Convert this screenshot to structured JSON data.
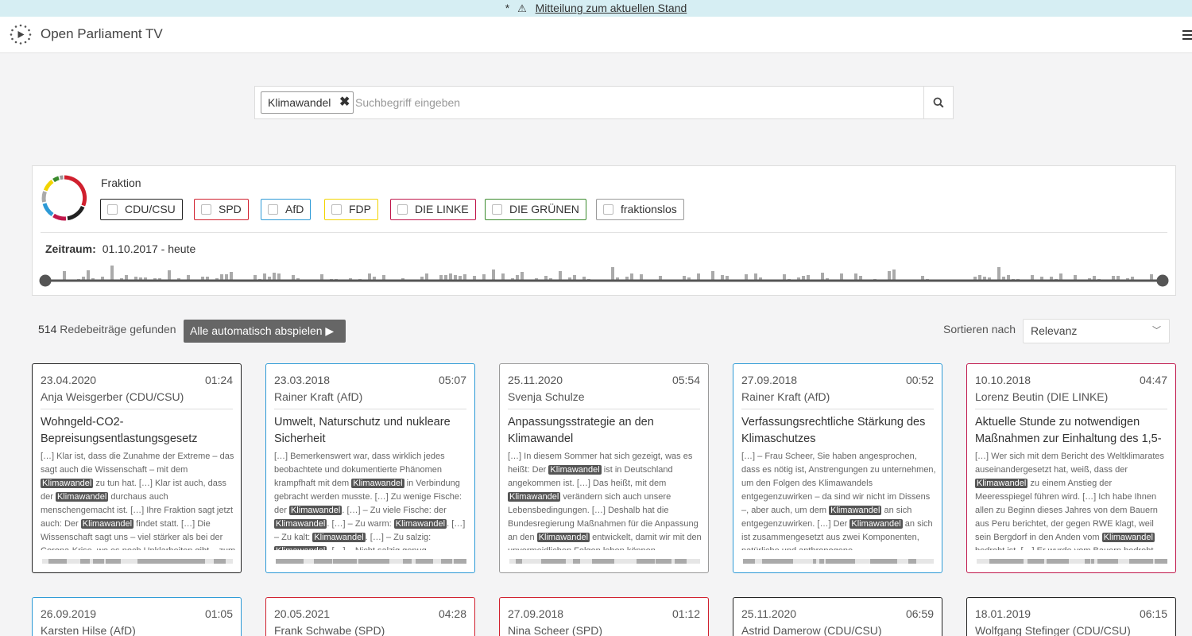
{
  "notice": {
    "prefix": "*",
    "link": "Mitteilung zum aktuellen Stand"
  },
  "brand": "Open Parliament TV",
  "search": {
    "chip": "Klimawandel",
    "placeholder": "Suchbegriff eingeben"
  },
  "filter": {
    "fraktion_label": "Fraktion",
    "parties": [
      {
        "label": "CDU/CSU",
        "color": "#222222"
      },
      {
        "label": "SPD",
        "color": "#d0202e"
      },
      {
        "label": "AfD",
        "color": "#2d9ad6"
      },
      {
        "label": "FDP",
        "color": "#f2d400"
      },
      {
        "label": "DIE LINKE",
        "color": "#c0174b"
      },
      {
        "label": "DIE GRÜNEN",
        "color": "#3a8a2c"
      },
      {
        "label": "fraktionslos",
        "color": "#999999"
      }
    ],
    "zeitraum_label": "Zeitraum:",
    "zeitraum_value": "01.10.2017 - heute"
  },
  "results": {
    "count": "514",
    "count_label": "Redebeiträge gefunden",
    "autoplay": "Alle automatisch abspielen ▶",
    "sort_label": "Sortieren nach",
    "sort_value": "Relevanz"
  },
  "cards": [
    {
      "date": "23.04.2020",
      "duration": "01:24",
      "speaker": "Anja Weisgerber (CDU/CSU)",
      "title": "Wohngeld-CO2-Bepreisungsentlastungsgesetz",
      "color": "#222222",
      "snippet": [
        "[…] Klar ist, dass die Zunahme der Extreme – das sagt auch die Wissenschaft – mit dem ",
        "Klimawandel",
        " zu tun hat. […] Klar ist auch, dass der ",
        "Klimawandel",
        " durchaus auch menschengemacht ist. […] Ihre Fraktion sagt jetzt auch: Der ",
        "Klimawandel",
        " findet statt. […] Die Wissenschaft sagt uns – viel stärker als bei der Corona-Krise, wo es noch Unklarheiten gibt – zum ",
        "Klimawandel",
        " sehr viel."
      ]
    },
    {
      "date": "23.03.2018",
      "duration": "05:07",
      "speaker": "Rainer Kraft (AfD)",
      "title": "Umwelt, Naturschutz und nukleare Sicherheit",
      "color": "#2d9ad6",
      "snippet": [
        "[…] Bemerkenswert war, dass wirklich jedes beobachtete und dokumentierte Phänomen krampfhaft mit dem ",
        "Klimawandel",
        " in Verbindung gebracht werden musste. […] Zu wenige Fische: der ",
        "Klimawandel",
        ". […] – Zu viele Fische: der ",
        "Klimawandel",
        ". […] – Zu warm: ",
        "Klimawandel",
        ". […] – Zu kalt: ",
        "Klimawandel",
        ". […] – Zu salzig: ",
        "Klimawandel",
        ". […] – Nicht salzig genug."
      ]
    },
    {
      "date": "25.11.2020",
      "duration": "05:54",
      "speaker": "Svenja Schulze",
      "title": "Anpassungsstrategie an den Klimawandel",
      "color": "#999999",
      "snippet": [
        "[…] In diesem Sommer hat sich gezeigt, was es heißt: Der ",
        "Klimawandel",
        " ist in Deutschland angekommen ist. […] Das heißt, mit dem ",
        "Klimawandel",
        " verändern sich auch unsere Lebensbedingungen. […] Deshalb hat die Bundesregierung Maßnahmen für die Anpassung an den ",
        "Klimawandel",
        " entwickelt, damit wir mit den unvermeidlichen Folgen leben können."
      ]
    },
    {
      "date": "27.09.2018",
      "duration": "00:52",
      "speaker": "Rainer Kraft (AfD)",
      "title": "Verfassungsrechtliche Stärkung des Klimaschutzes",
      "color": "#2d9ad6",
      "snippet": [
        "[…] – Frau Scheer, Sie haben angesprochen, dass es nötig ist, Anstrengungen zu unternehmen, um den Folgen des Klimawandels entgegenzuwirken – da sind wir nicht im Dissens –, aber auch, um dem ",
        "Klimawandel",
        " an sich entgegenzuwirken. […] Der ",
        "Klimawandel",
        " an sich ist zusammengesetzt aus zwei Komponenten, natürliche und anthropogene."
      ]
    },
    {
      "date": "10.10.2018",
      "duration": "04:47",
      "speaker": "Lorenz Beutin (DIE LINKE)",
      "title": "Aktuelle Stunde zu notwendigen Maßnahmen zur Einhaltung des 1,5-Grad-Ziels",
      "color": "#c0174b",
      "snippet": [
        "[…] Wer sich mit dem Bericht des Weltklimarates auseinandergesetzt hat, weiß, dass der ",
        "Klimawandel",
        " zu einem Anstieg der Meeresspiegel führen wird. […] Ich habe Ihnen allen zu Beginn dieses Jahres von dem Bauern aus Peru berichtet, der gegen RWE klagt, weil sein Bergdorf in den Anden vom ",
        "Klimawandel",
        " bedroht ist. […] Er wurde vom Bauern bedroht."
      ]
    },
    {
      "date": "26.09.2019",
      "duration": "01:05",
      "speaker": "Karsten Hilse (AfD)",
      "title": "",
      "color": "#2d9ad6",
      "snippet": []
    },
    {
      "date": "20.05.2021",
      "duration": "04:28",
      "speaker": "Frank Schwabe (SPD)",
      "title": "",
      "color": "#d0202e",
      "snippet": []
    },
    {
      "date": "27.09.2018",
      "duration": "01:12",
      "speaker": "Nina Scheer (SPD)",
      "title": "",
      "color": "#d0202e",
      "snippet": []
    },
    {
      "date": "25.11.2020",
      "duration": "06:59",
      "speaker": "Astrid Damerow (CDU/CSU)",
      "title": "",
      "color": "#222222",
      "snippet": []
    },
    {
      "date": "18.01.2019",
      "duration": "06:15",
      "speaker": "Wolfgang Stefinger (CDU/CSU)",
      "title": "",
      "color": "#222222",
      "snippet": []
    }
  ]
}
